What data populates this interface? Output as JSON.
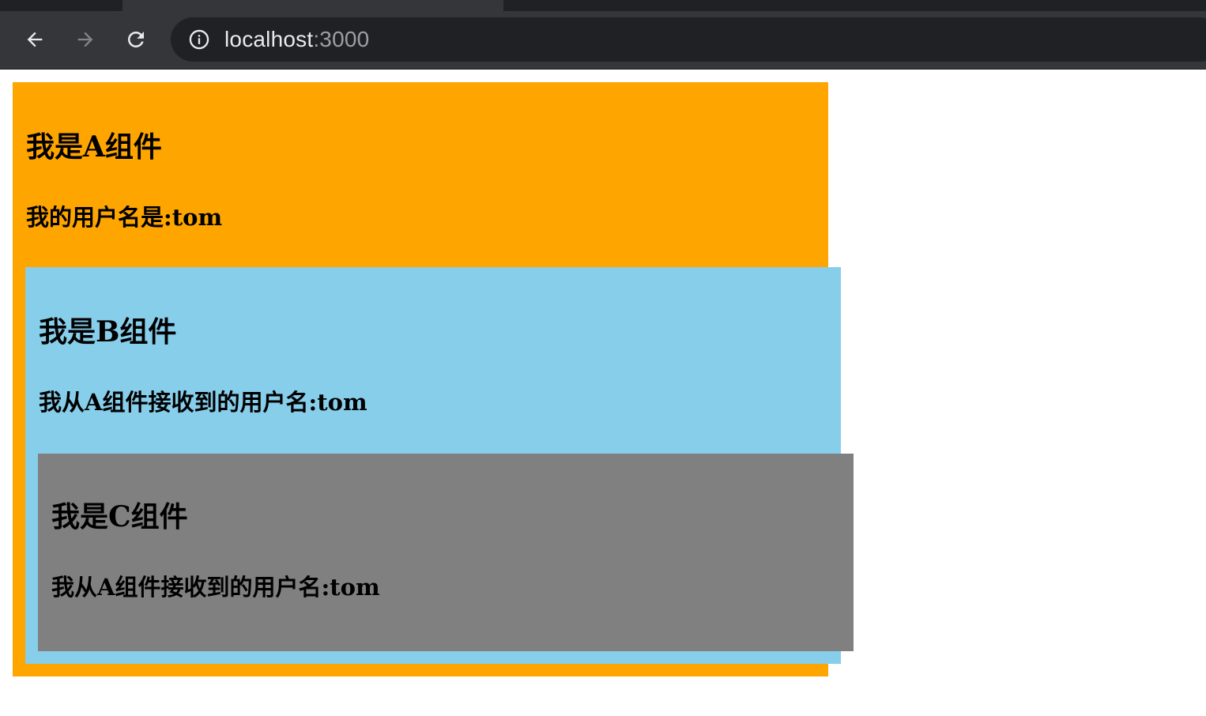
{
  "browser": {
    "url_host": "localhost",
    "url_port": ":3000",
    "icons": {
      "back": "back-arrow-icon",
      "forward": "forward-arrow-icon",
      "reload": "reload-icon",
      "site_info": "info-icon"
    }
  },
  "components": {
    "a": {
      "title": "我是A组件",
      "text": "我的用户名是:tom",
      "color": "#ffa500"
    },
    "b": {
      "title": "我是B组件",
      "text": "我从A组件接收到的用户名:tom",
      "color": "#87ceeb"
    },
    "c": {
      "title": "我是C组件",
      "text": "我从A组件接收到的用户名:tom",
      "color": "#808080"
    }
  }
}
